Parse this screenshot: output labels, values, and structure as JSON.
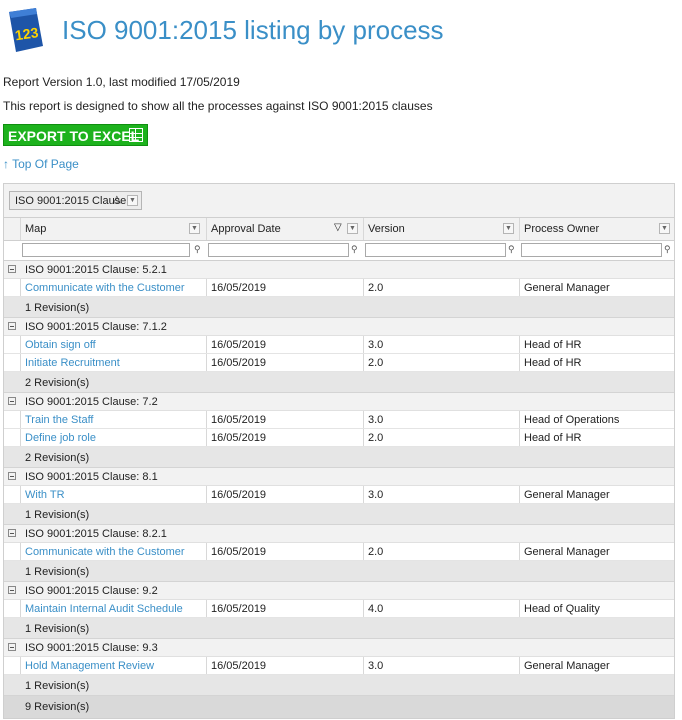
{
  "header": {
    "logo_text": "123",
    "title": "ISO 9001:2015 listing by process"
  },
  "info": {
    "version_line": "Report Version 1.0, last modified 17/05/2019",
    "description": "This report is designed to show all the processes against ISO 9001:2015 clauses"
  },
  "toolbar": {
    "export_label": "EXPORT TO EXCEL",
    "top_link": "↑ Top Of Page"
  },
  "grid": {
    "group_by_label": "ISO 9001:2015 Clause",
    "columns": [
      {
        "label": "Map"
      },
      {
        "label": "Approval Date"
      },
      {
        "label": "Version"
      },
      {
        "label": "Process Owner"
      }
    ],
    "groups": [
      {
        "label": "ISO 9001:2015 Clause: 5.2.1",
        "rows": [
          {
            "map": "Communicate with the Customer",
            "date": "16/05/2019",
            "version": "2.0",
            "owner": "General Manager"
          }
        ],
        "footer": "1 Revision(s)"
      },
      {
        "label": "ISO 9001:2015 Clause: 7.1.2",
        "rows": [
          {
            "map": "Obtain sign off",
            "date": "16/05/2019",
            "version": "3.0",
            "owner": "Head of HR"
          },
          {
            "map": "Initiate Recruitment",
            "date": "16/05/2019",
            "version": "2.0",
            "owner": "Head of HR"
          }
        ],
        "footer": "2 Revision(s)"
      },
      {
        "label": "ISO 9001:2015 Clause: 7.2",
        "rows": [
          {
            "map": "Train the Staff",
            "date": "16/05/2019",
            "version": "3.0",
            "owner": "Head of Operations"
          },
          {
            "map": "Define job role",
            "date": "16/05/2019",
            "version": "2.0",
            "owner": "Head of HR"
          }
        ],
        "footer": "2 Revision(s)"
      },
      {
        "label": "ISO 9001:2015 Clause: 8.1",
        "rows": [
          {
            "map": "With TR",
            "date": "16/05/2019",
            "version": "3.0",
            "owner": "General Manager"
          }
        ],
        "footer": "1 Revision(s)"
      },
      {
        "label": "ISO 9001:2015 Clause: 8.2.1",
        "rows": [
          {
            "map": "Communicate with the Customer",
            "date": "16/05/2019",
            "version": "2.0",
            "owner": "General Manager"
          }
        ],
        "footer": "1 Revision(s)"
      },
      {
        "label": "ISO 9001:2015 Clause: 9.2",
        "rows": [
          {
            "map": "Maintain Internal Audit Schedule",
            "date": "16/05/2019",
            "version": "4.0",
            "owner": "Head of Quality"
          }
        ],
        "footer": "1 Revision(s)"
      },
      {
        "label": "ISO 9001:2015 Clause: 9.3",
        "rows": [
          {
            "map": "Hold Management Review",
            "date": "16/05/2019",
            "version": "3.0",
            "owner": "General Manager"
          }
        ],
        "footer": "1 Revision(s)"
      }
    ],
    "total": "9 Revision(s)"
  }
}
